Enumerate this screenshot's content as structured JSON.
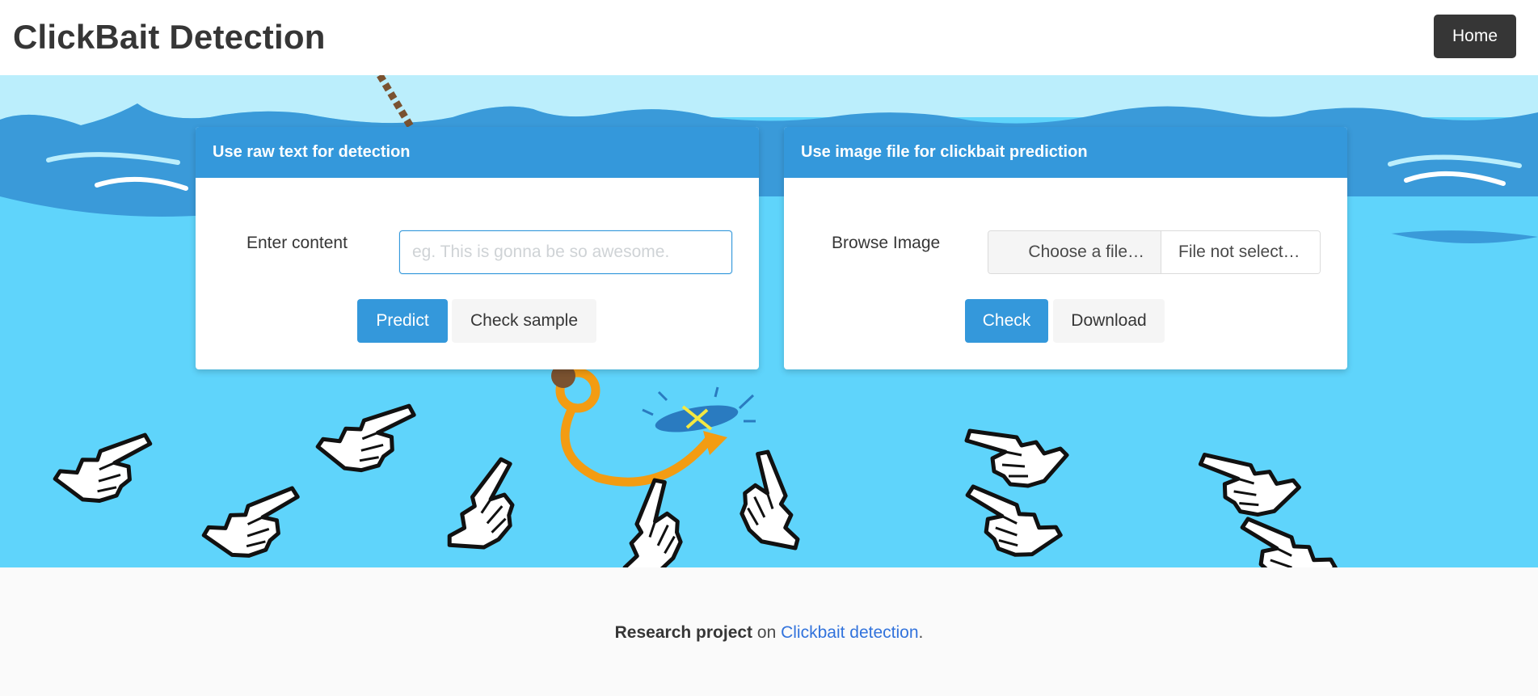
{
  "navbar": {
    "brand": "ClickBait Detection",
    "home_label": "Home"
  },
  "text_card": {
    "header": "Use raw text for detection",
    "label": "Enter content",
    "input_value": "",
    "input_placeholder": "eg. This is gonna be so awesome.",
    "predict_label": "Predict",
    "sample_label": "Check sample"
  },
  "image_card": {
    "header": "Use image file for clickbait prediction",
    "label": "Browse Image",
    "choose_label": "Choose a file…",
    "file_name": "File not select…",
    "check_label": "Check",
    "download_label": "Download"
  },
  "footer": {
    "strong": "Research project",
    "middle": " on ",
    "link": "Clickbait detection",
    "end": "."
  },
  "colors": {
    "primary": "#3498db",
    "dark": "#363636",
    "link": "#3273dc",
    "sky": "#5fd4fb",
    "hook": "#f39c12"
  },
  "illustration": {
    "icons": [
      "rope-icon",
      "fishing-hook-icon",
      "bait-icon",
      "pointer-hand-icon"
    ]
  }
}
